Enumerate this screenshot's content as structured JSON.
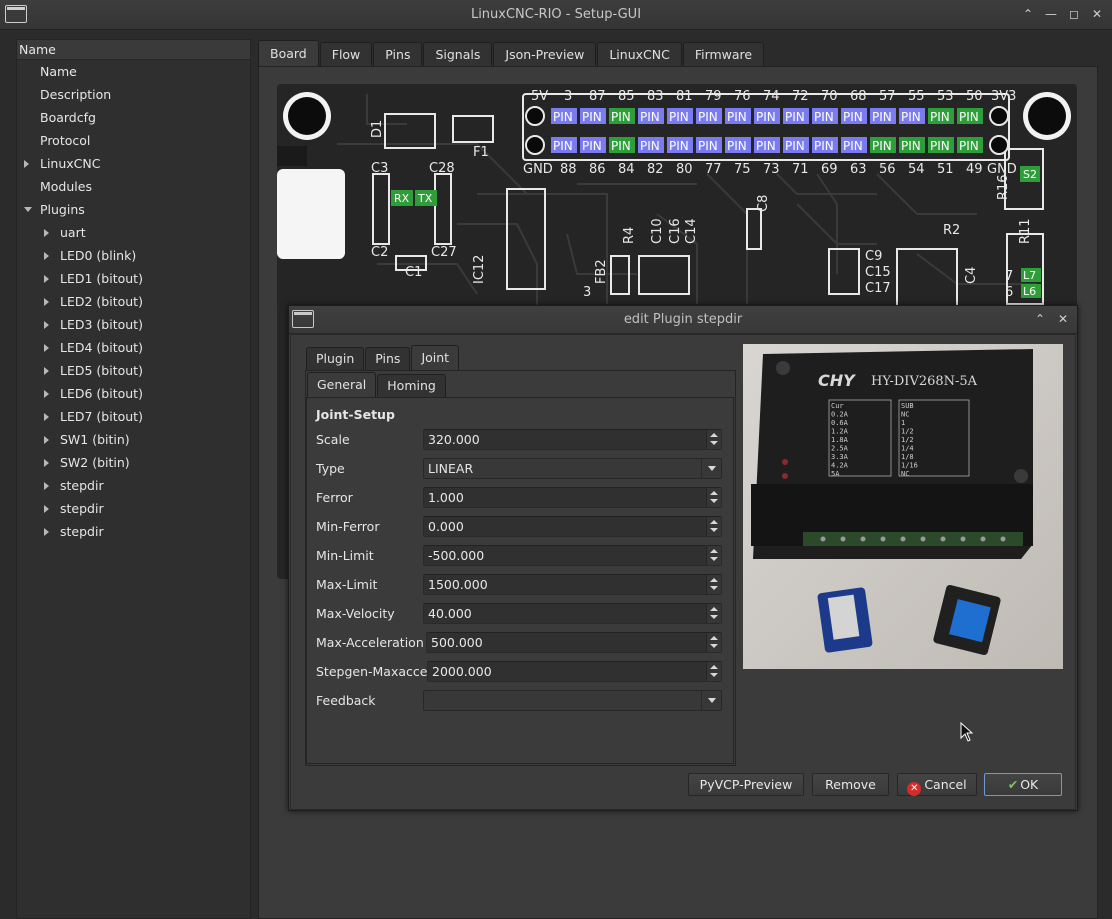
{
  "window": {
    "title": "LinuxCNC-RIO - Setup-GUI",
    "icon": "app-window-icon",
    "controls": [
      "chevron-up-icon",
      "minimize-icon",
      "maximize-icon",
      "close-icon"
    ]
  },
  "tree": {
    "header": "Name",
    "items": [
      {
        "label": "Name",
        "level": 1,
        "arrow": "none"
      },
      {
        "label": "Description",
        "level": 1,
        "arrow": "none"
      },
      {
        "label": "Boardcfg",
        "level": 1,
        "arrow": "none"
      },
      {
        "label": "Protocol",
        "level": 1,
        "arrow": "none"
      },
      {
        "label": "LinuxCNC",
        "level": 1,
        "arrow": "right"
      },
      {
        "label": "Modules",
        "level": 1,
        "arrow": "none"
      },
      {
        "label": "Plugins",
        "level": 1,
        "arrow": "down"
      },
      {
        "label": "uart",
        "level": 2,
        "arrow": "right"
      },
      {
        "label": "LED0 (blink)",
        "level": 2,
        "arrow": "right"
      },
      {
        "label": "LED1 (bitout)",
        "level": 2,
        "arrow": "right"
      },
      {
        "label": "LED2 (bitout)",
        "level": 2,
        "arrow": "right"
      },
      {
        "label": "LED3 (bitout)",
        "level": 2,
        "arrow": "right"
      },
      {
        "label": "LED4 (bitout)",
        "level": 2,
        "arrow": "right"
      },
      {
        "label": "LED5 (bitout)",
        "level": 2,
        "arrow": "right"
      },
      {
        "label": "LED6 (bitout)",
        "level": 2,
        "arrow": "right"
      },
      {
        "label": "LED7 (bitout)",
        "level": 2,
        "arrow": "right"
      },
      {
        "label": "SW1 (bitin)",
        "level": 2,
        "arrow": "right"
      },
      {
        "label": "SW2 (bitin)",
        "level": 2,
        "arrow": "right"
      },
      {
        "label": "stepdir",
        "level": 2,
        "arrow": "right"
      },
      {
        "label": "stepdir",
        "level": 2,
        "arrow": "right"
      },
      {
        "label": "stepdir",
        "level": 2,
        "arrow": "right"
      }
    ]
  },
  "main_tabs": [
    "Board",
    "Flow",
    "Pins",
    "Signals",
    "Json-Preview",
    "LinuxCNC",
    "Firmware"
  ],
  "main_active_tab": "Board",
  "board": {
    "top_labels": [
      "5V",
      "3",
      "87",
      "85",
      "83",
      "81",
      "79",
      "76",
      "74",
      "72",
      "70",
      "68",
      "57",
      "55",
      "53",
      "50",
      "3V3"
    ],
    "bottom_labels": [
      "GND",
      "88",
      "86",
      "84",
      "82",
      "80",
      "77",
      "75",
      "73",
      "71",
      "69",
      "63",
      "56",
      "54",
      "51",
      "49",
      "GND"
    ],
    "pin_text": "PIN",
    "top_pin_colors": [
      "blue",
      "blue",
      "green",
      "blue",
      "blue",
      "blue",
      "blue",
      "blue",
      "blue",
      "blue",
      "blue",
      "blue",
      "blue",
      "green",
      "green"
    ],
    "bottom_pin_colors": [
      "blue",
      "blue",
      "green",
      "blue",
      "blue",
      "blue",
      "blue",
      "blue",
      "blue",
      "blue",
      "blue",
      "green",
      "green",
      "green",
      "green"
    ],
    "silk": {
      "d1": "D1",
      "f1": "F1",
      "c3": "C3",
      "c28": "C28",
      "rx": "RX",
      "tx": "TX",
      "c2": "C2",
      "c27": "C27",
      "c1": "C1",
      "c8": "C8",
      "r4": "R4",
      "c10": "C10",
      "c16": "C16",
      "c14": "C14",
      "ic12": "IC12",
      "fb2": "FB2",
      "n3": "3",
      "c9": "C9",
      "c15": "C15",
      "c17": "C17",
      "r2": "R2",
      "c4": "C4",
      "s2": "S2",
      "r16": "R16",
      "r11": "R11",
      "l7": "L7",
      "l6": "L6",
      "n7": "7",
      "n6": "6"
    },
    "pin_green": "#2e9e3a",
    "pin_blue": "#7b7bf0"
  },
  "dialog": {
    "title": "edit Plugin stepdir",
    "tabs": [
      "Plugin",
      "Pins",
      "Joint"
    ],
    "active_tab": "Joint",
    "subtabs": [
      "General",
      "Homing"
    ],
    "active_subtab": "General",
    "section_title": "Joint-Setup",
    "fields": [
      {
        "label": "Scale",
        "value": "320.000",
        "kind": "spin"
      },
      {
        "label": "Type",
        "value": "LINEAR",
        "kind": "combo"
      },
      {
        "label": "Ferror",
        "value": "1.000",
        "kind": "spin"
      },
      {
        "label": "Min-Ferror",
        "value": "0.000",
        "kind": "spin"
      },
      {
        "label": "Min-Limit",
        "value": "-500.000",
        "kind": "spin"
      },
      {
        "label": "Max-Limit",
        "value": "1500.000",
        "kind": "spin"
      },
      {
        "label": "Max-Velocity",
        "value": "40.000",
        "kind": "spin"
      },
      {
        "label": "Max-Acceleration",
        "value": "500.000",
        "kind": "spin"
      },
      {
        "label": "Stepgen-Maxaccel",
        "value": "2000.000",
        "kind": "spin"
      },
      {
        "label": "Feedback",
        "value": "",
        "kind": "combo"
      }
    ],
    "buttons": {
      "pyvcp": "PyVCP-Preview",
      "remove": "Remove",
      "cancel": "Cancel",
      "ok": "OK"
    },
    "photo": {
      "brand": "HY-DIV268N-5A",
      "logo": "CHY",
      "table_left": [
        "Cur",
        "0.2A",
        "0.6A",
        "1.2A",
        "1.8A",
        "2.5A",
        "3.3A",
        "4.2A",
        "5A"
      ],
      "table_right": [
        "SUB",
        "NC",
        "1",
        "1/2",
        "1/2",
        "1/4",
        "1/8",
        "1/16",
        "NC"
      ]
    }
  }
}
